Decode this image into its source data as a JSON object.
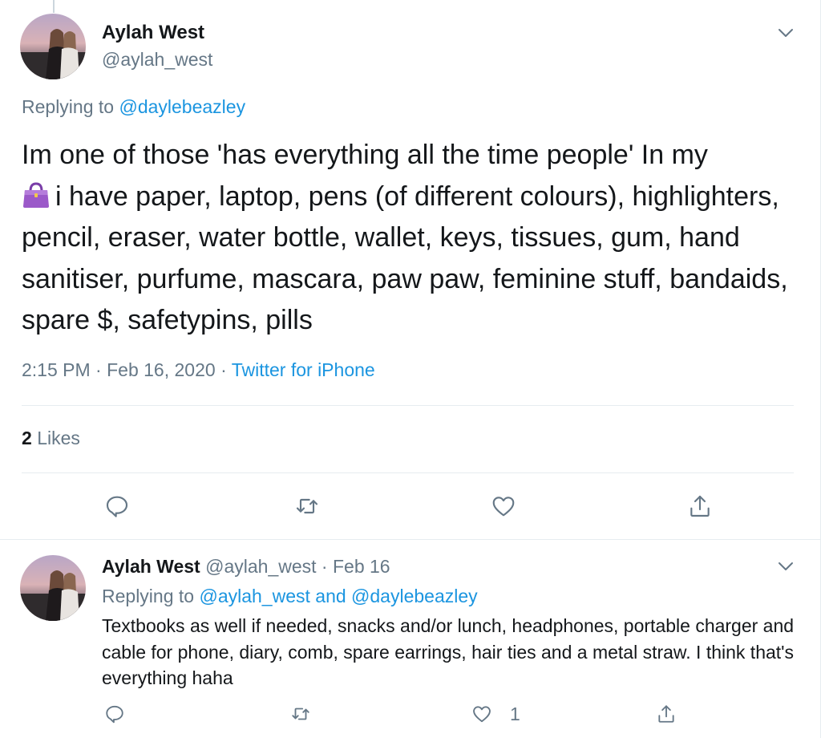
{
  "main_tweet": {
    "author_name": "Aylah West",
    "author_handle": "@aylah_west",
    "replying_label": "Replying to",
    "replying_handle": "@daylebeazley",
    "emoji": "handbag-emoji",
    "text_before_emoji": "Im one of those 'has everything all the time people' In my",
    "text_after_emoji": "i have paper, laptop, pens (of different colours), highlighters, pencil, eraser, water bottle, wallet, keys, tissues, gum, hand sanitiser, purfume, mascara, paw paw, feminine stuff, bandaids, spare $, safetypins, pills",
    "time": "2:15 PM",
    "date": "Feb 16, 2020",
    "separator": "·",
    "source": "Twitter for iPhone",
    "likes_count": "2",
    "likes_label": "Likes"
  },
  "reply_tweet": {
    "author_name": "Aylah West",
    "author_handle": "@aylah_west",
    "separator": "·",
    "date": "Feb 16",
    "replying_label": "Replying to",
    "replying_handles": "@aylah_west and @daylebeazley",
    "text": "Textbooks as well if needed, snacks and/or lunch, headphones, portable charger and cable for phone, diary, comb, spare earrings, hair ties and a metal straw. I think that's everything haha",
    "like_count": "1"
  },
  "icons": {
    "reply": "reply-icon",
    "retweet": "retweet-icon",
    "like": "heart-icon",
    "share": "share-icon",
    "more": "chevron-down-icon"
  },
  "colors": {
    "link": "#1b95e0",
    "secondary_text": "#657786",
    "primary_text": "#14171a",
    "divider": "#e6ecf0"
  }
}
